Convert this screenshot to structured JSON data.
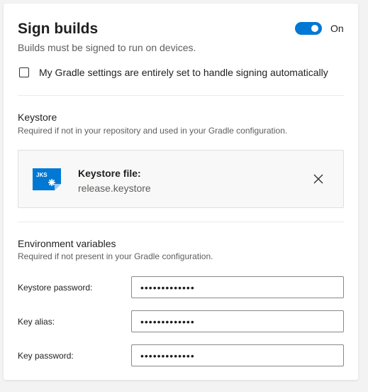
{
  "header": {
    "title": "Sign builds",
    "subtitle": "Builds must be signed to run on devices.",
    "toggle": {
      "state": "On",
      "enabled": true,
      "color": "#0078d4"
    }
  },
  "auto_signing": {
    "checked": false,
    "label": "My Gradle settings are entirely set to handle signing automatically"
  },
  "keystore": {
    "title": "Keystore",
    "description": "Required if not in your repository and used in your Gradle configuration.",
    "file": {
      "icon_label": "JKS",
      "label": "Keystore file:",
      "name": "release.keystore"
    }
  },
  "env": {
    "title": "Environment variables",
    "description": "Required if not present in your Gradle configuration.",
    "fields": [
      {
        "label": "Keystore password:",
        "value": "•••••••••••••"
      },
      {
        "label": "Key alias:",
        "value": "•••••••••••••"
      },
      {
        "label": "Key password:",
        "value": "•••••••••••••"
      }
    ]
  }
}
